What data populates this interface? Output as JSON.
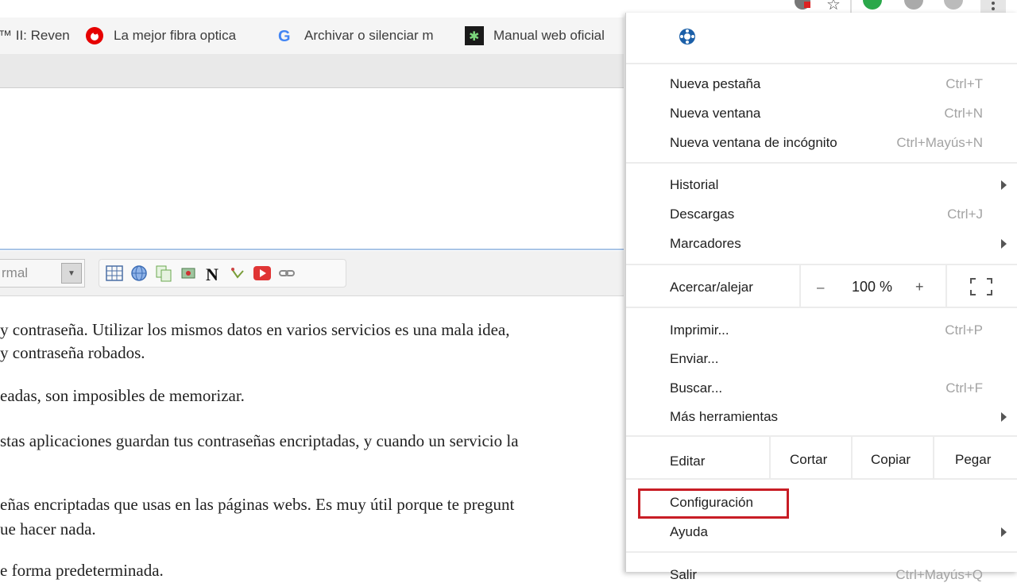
{
  "bookmarks": [
    {
      "label": "™ II: Reven",
      "icon": "bookmark-icon"
    },
    {
      "label": "La mejor fibra optica",
      "icon": "vodafone-icon"
    },
    {
      "label": "Archivar o silenciar m",
      "icon": "google-icon"
    },
    {
      "label": "Manual web oficial",
      "icon": "manual-icon"
    }
  ],
  "toolbar": {
    "format_value": "rmal"
  },
  "content_lines": [
    "y contraseña. Utilizar los mismos datos en varios servicios es una mala idea,",
    "y contraseña robados.",
    "eadas, son imposibles de memorizar.",
    "stas aplicaciones guardan tus contraseñas encriptadas, y cuando un servicio la",
    "eñas encriptadas que usas en las páginas webs. Es muy útil porque te pregunt",
    "ue hacer nada.",
    "e forma predeterminada."
  ],
  "menu": {
    "new_tab": {
      "label": "Nueva pestaña",
      "shortcut": "Ctrl+T"
    },
    "new_window": {
      "label": "Nueva ventana",
      "shortcut": "Ctrl+N"
    },
    "incognito": {
      "label": "Nueva ventana de incógnito",
      "shortcut": "Ctrl+Mayús+N"
    },
    "history": {
      "label": "Historial"
    },
    "downloads": {
      "label": "Descargas",
      "shortcut": "Ctrl+J"
    },
    "bookmarks": {
      "label": "Marcadores"
    },
    "zoom": {
      "label": "Acercar/alejar",
      "minus": "–",
      "value": "100 %",
      "plus": "+"
    },
    "print": {
      "label": "Imprimir...",
      "shortcut": "Ctrl+P"
    },
    "cast": {
      "label": "Enviar..."
    },
    "find": {
      "label": "Buscar...",
      "shortcut": "Ctrl+F"
    },
    "more_tools": {
      "label": "Más herramientas"
    },
    "edit": {
      "label": "Editar",
      "cut": "Cortar",
      "copy": "Copiar",
      "paste": "Pegar"
    },
    "settings": {
      "label": "Configuración"
    },
    "help": {
      "label": "Ayuda"
    },
    "exit": {
      "label": "Salir",
      "shortcut": "Ctrl+Mayús+Q"
    }
  },
  "colors": {
    "highlight": "#c81d25",
    "shortcut_text": "#a3a3a3"
  }
}
